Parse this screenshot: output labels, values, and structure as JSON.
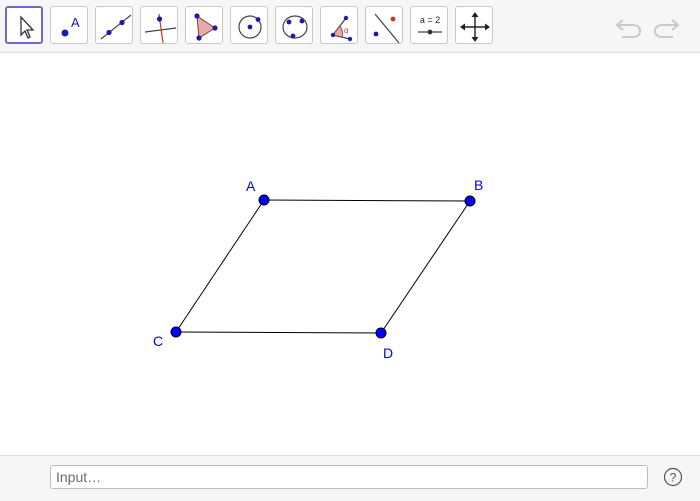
{
  "toolbar": {
    "tools": [
      {
        "id": "move",
        "icon": "move-cursor-icon",
        "selected": true
      },
      {
        "id": "point",
        "icon": "point-icon",
        "icon_text": "A"
      },
      {
        "id": "line",
        "icon": "line-through-two-points-icon"
      },
      {
        "id": "perpendicular",
        "icon": "perpendicular-line-icon"
      },
      {
        "id": "polygon",
        "icon": "polygon-icon"
      },
      {
        "id": "circle",
        "icon": "circle-center-point-icon"
      },
      {
        "id": "circle-three-points",
        "icon": "circle-through-three-points-icon"
      },
      {
        "id": "angle",
        "icon": "angle-icon",
        "icon_text": "α"
      },
      {
        "id": "reflect",
        "icon": "reflect-about-line-icon"
      },
      {
        "id": "slider",
        "icon": "slider-icon",
        "icon_text": "a = 2"
      },
      {
        "id": "move-graphics",
        "icon": "move-graphics-view-icon"
      }
    ],
    "undo_icon": "undo-icon",
    "redo_icon": "redo-icon"
  },
  "colors": {
    "point": "#0000ff",
    "label": "#0000ff",
    "segment": "#000000",
    "selected_border": "#6a6ad0",
    "toolbar_bg": "#f6f6f6"
  },
  "construction": {
    "points": [
      {
        "name": "A"
      },
      {
        "name": "B"
      },
      {
        "name": "C"
      },
      {
        "name": "D"
      }
    ],
    "segments": [
      [
        "A",
        "B"
      ],
      [
        "B",
        "D"
      ],
      [
        "D",
        "C"
      ],
      [
        "C",
        "A"
      ]
    ]
  },
  "input_bar": {
    "placeholder": "Input…",
    "value": "",
    "help_label": "?"
  }
}
